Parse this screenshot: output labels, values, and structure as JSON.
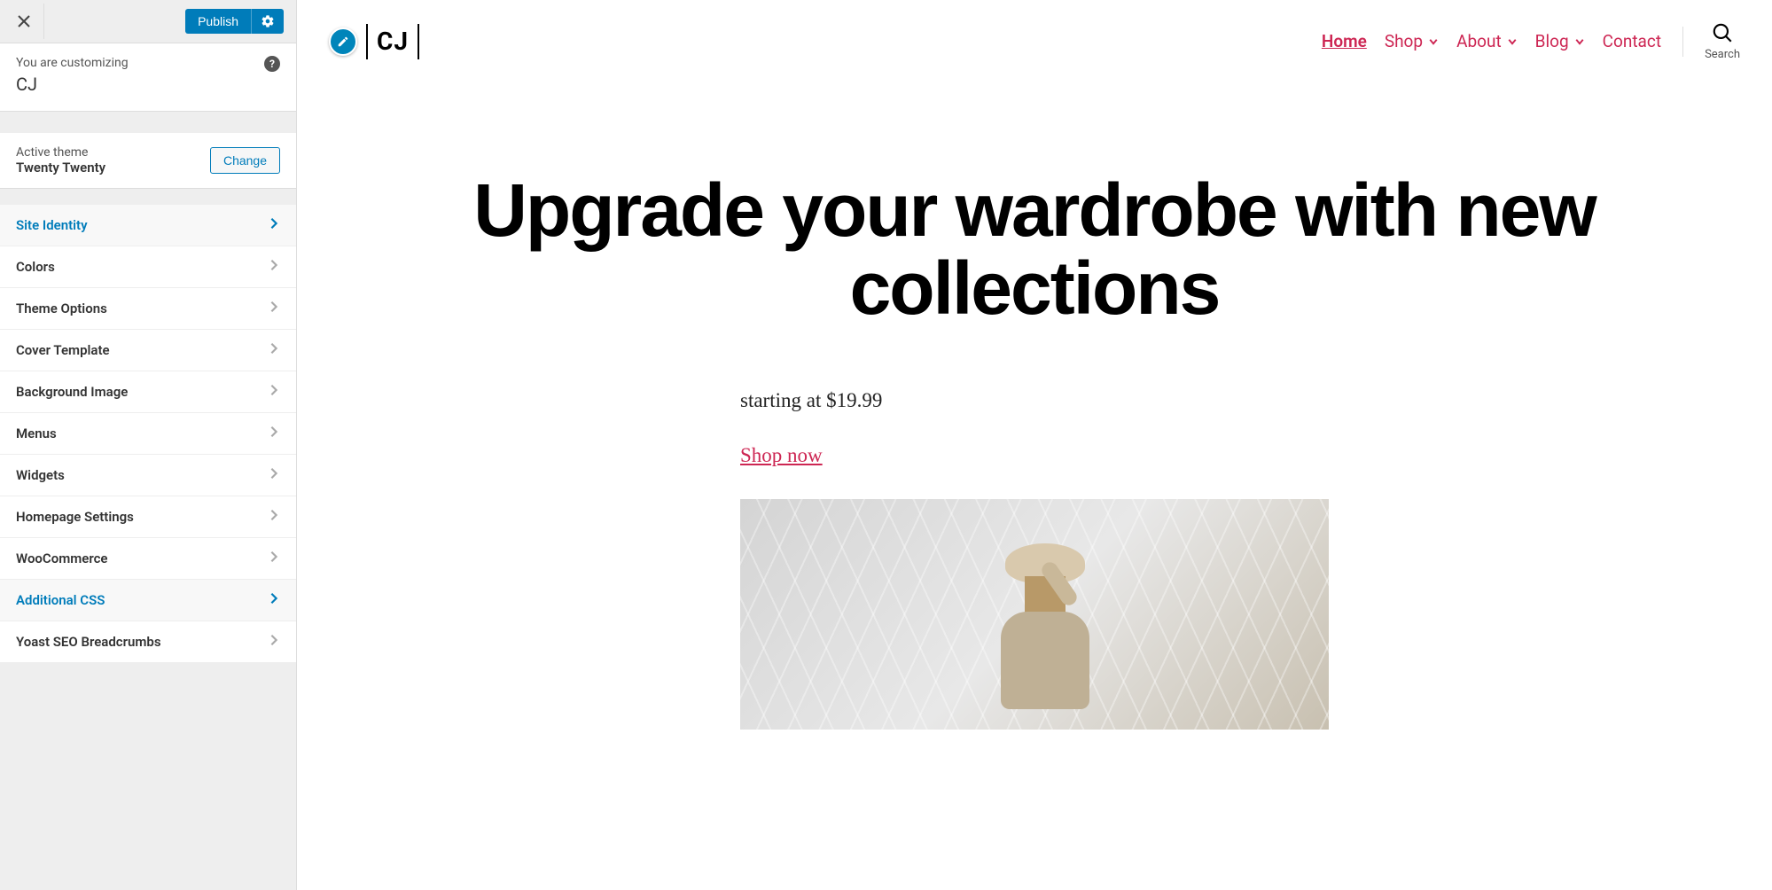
{
  "sidebar": {
    "publish_label": "Publish",
    "customizing_label": "You are customizing",
    "site_name": "CJ",
    "active_theme_label": "Active theme",
    "theme_name": "Twenty Twenty",
    "change_label": "Change",
    "menu_items": [
      {
        "label": "Site Identity",
        "active": true
      },
      {
        "label": "Colors",
        "active": false
      },
      {
        "label": "Theme Options",
        "active": false
      },
      {
        "label": "Cover Template",
        "active": false
      },
      {
        "label": "Background Image",
        "active": false
      },
      {
        "label": "Menus",
        "active": false
      },
      {
        "label": "Widgets",
        "active": false
      },
      {
        "label": "Homepage Settings",
        "active": false
      },
      {
        "label": "WooCommerce",
        "active": false
      },
      {
        "label": "Additional CSS",
        "active": true
      },
      {
        "label": "Yoast SEO Breadcrumbs",
        "active": false
      }
    ]
  },
  "preview": {
    "logo_text": "CJ",
    "nav": [
      {
        "label": "Home",
        "dropdown": false,
        "current": true
      },
      {
        "label": "Shop",
        "dropdown": true,
        "current": false
      },
      {
        "label": "About",
        "dropdown": true,
        "current": false
      },
      {
        "label": "Blog",
        "dropdown": true,
        "current": false
      },
      {
        "label": "Contact",
        "dropdown": false,
        "current": false
      }
    ],
    "search_label": "Search",
    "hero_title": "Upgrade your wardrobe with new collections",
    "price_text": "starting at $19.99",
    "shop_link": "Shop now"
  }
}
